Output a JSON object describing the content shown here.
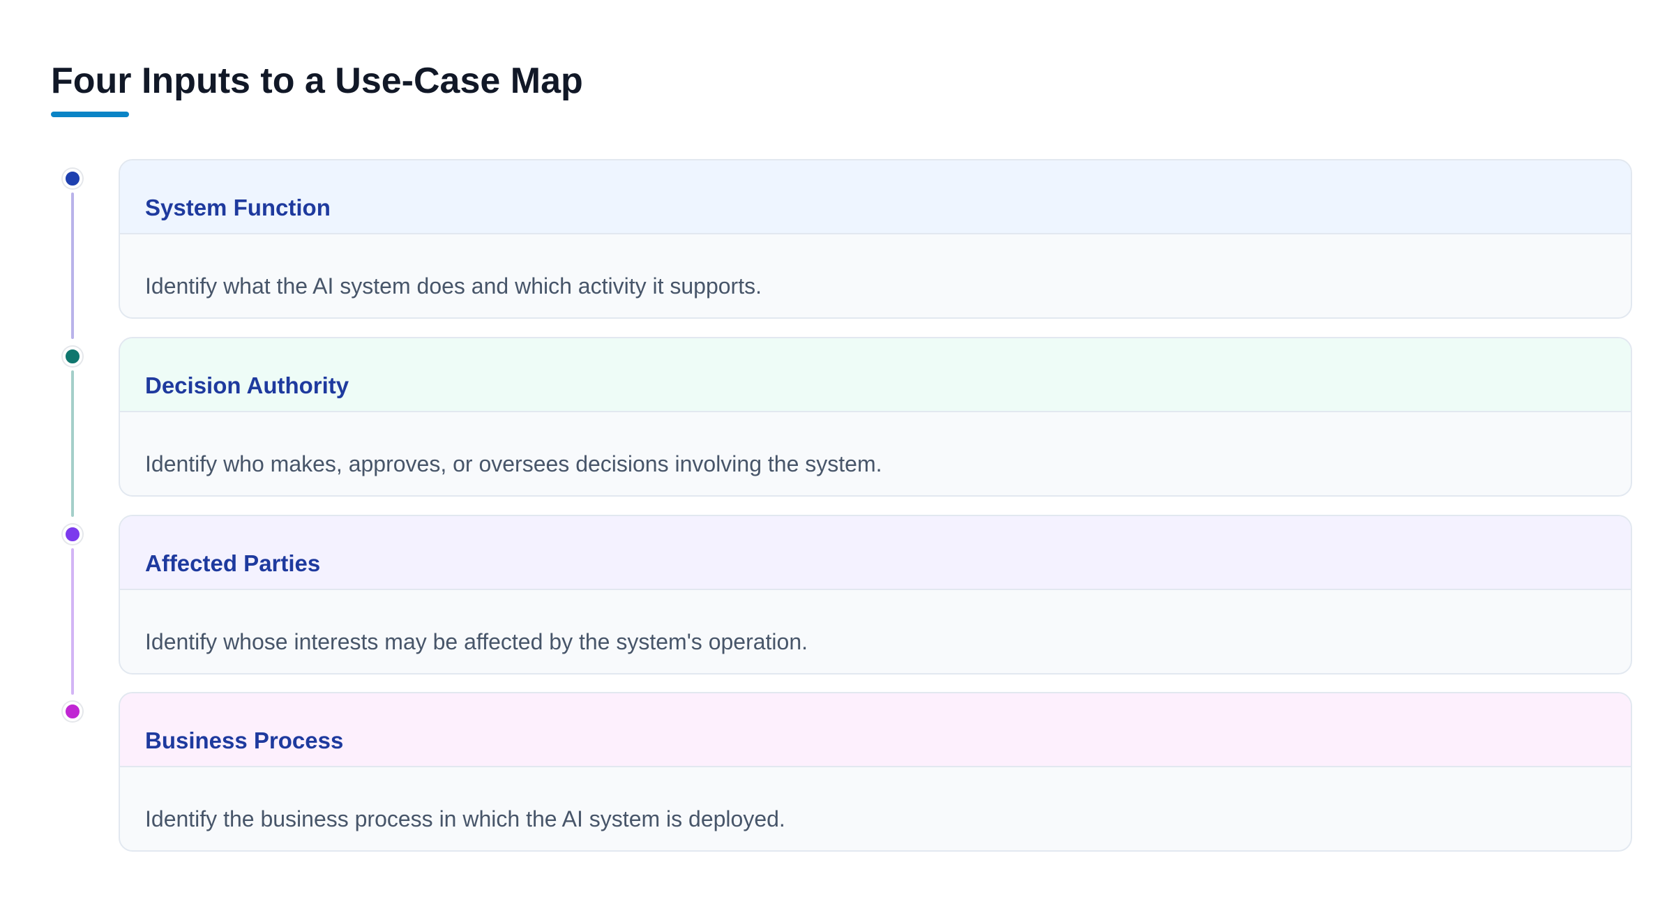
{
  "title": "Four Inputs to a Use-Case Map",
  "accent_color": "#0a84c6",
  "steps": [
    {
      "title": "System Function",
      "description": "Identify what the AI system does and which activity it supports.",
      "dot_color": "#1e40af",
      "line_color": "#b9b3ea",
      "header_bg": "#eef5ff"
    },
    {
      "title": "Decision Authority",
      "description": "Identify who makes, approves, or oversees decisions involving the system.",
      "dot_color": "#0f766e",
      "line_color": "#a4cfc9",
      "header_bg": "#eefcf7"
    },
    {
      "title": "Affected Parties",
      "description": "Identify whose interests may be affected by the system's operation.",
      "dot_color": "#7c3aed",
      "line_color": "#d3b5f5",
      "header_bg": "#f4f2ff"
    },
    {
      "title": "Business Process",
      "description": "Identify the business process in which the AI system is deployed.",
      "dot_color": "#c026d3",
      "line_color": "",
      "header_bg": "#fdf0fd"
    }
  ]
}
